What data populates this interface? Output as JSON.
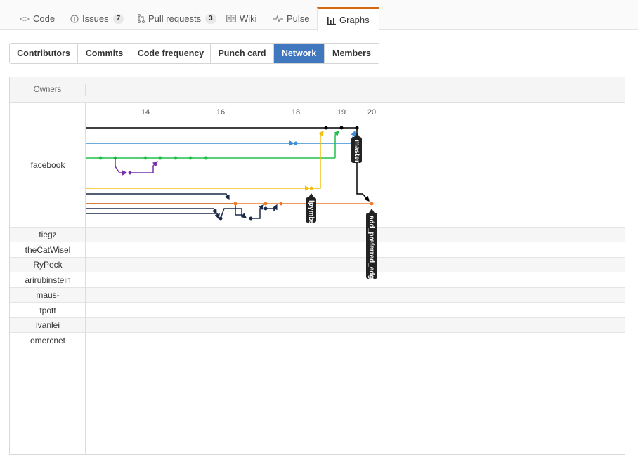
{
  "reponav": {
    "items": [
      {
        "label": "Code",
        "icon": "code-icon",
        "counter": null
      },
      {
        "label": "Issues",
        "icon": "issue-icon",
        "counter": "7"
      },
      {
        "label": "Pull requests",
        "icon": "pull-request-icon",
        "counter": "3"
      },
      {
        "label": "Wiki",
        "icon": "book-icon",
        "counter": null
      },
      {
        "label": "Pulse",
        "icon": "pulse-icon",
        "counter": null
      },
      {
        "label": "Graphs",
        "icon": "graph-icon",
        "counter": null,
        "selected": true
      }
    ]
  },
  "subnav": {
    "items": [
      {
        "label": "Contributors"
      },
      {
        "label": "Commits"
      },
      {
        "label": "Code frequency"
      },
      {
        "label": "Punch card"
      },
      {
        "label": "Network",
        "selected": true
      },
      {
        "label": "Members"
      }
    ]
  },
  "network": {
    "owners_label": "Owners",
    "dates": [
      "14",
      "16",
      "18",
      "19",
      "20"
    ],
    "owners": [
      "facebook",
      "tiegz",
      "theCatWisel",
      "RyPeck",
      "arirubinstein",
      "maus-",
      "tpott",
      "ivanlei",
      "omercnet"
    ],
    "branch_tags": [
      "master",
      "lpymbs",
      "add_preferred_edge"
    ],
    "colors": {
      "black": "#000000",
      "blue": "#3a8fd6",
      "green": "#22c04a",
      "purple": "#7a2fa8",
      "yellow": "#f3c012",
      "orange": "#ef7a2a",
      "navy": "#1b2a4a",
      "tag_bg": "#222222",
      "accent": "#4078c0",
      "tab_accent": "#d26911"
    }
  }
}
